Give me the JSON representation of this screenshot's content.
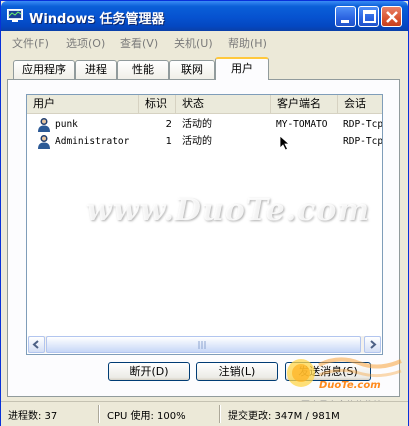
{
  "window": {
    "title": "Windows 任务管理器"
  },
  "menu": [
    "文件(F)",
    "选项(O)",
    "查看(V)",
    "关机(U)",
    "帮助(H)"
  ],
  "tabs": [
    "应用程序",
    "进程",
    "性能",
    "联网",
    "用户"
  ],
  "active_tab": "用户",
  "table": {
    "columns": [
      "用户",
      "标识",
      "状态",
      "客户端名",
      "会话"
    ],
    "rows": [
      {
        "user": "punk",
        "id": "2",
        "status": "活动的",
        "client": "MY-TOMATO",
        "session": "RDP-Tcp"
      },
      {
        "user": "Administrator",
        "id": "1",
        "status": "活动的",
        "client": "",
        "session": "RDP-Tcp"
      }
    ]
  },
  "buttons": {
    "disconnect": "断开(D)",
    "logoff": "注销(L)",
    "send_message": "发送消息(S)"
  },
  "status": {
    "processes": "进程数: 37",
    "cpu": "CPU 使用: 100%",
    "commit": "提交更改: 347M / 981M"
  },
  "watermark": "www.DuoTe.com",
  "logo": {
    "name": "DuoTe.com",
    "tagline": "国内最安全的软件站"
  },
  "colors": {
    "titlebar": "#0652d0",
    "tab_highlight": "#ffc83c",
    "close_button": "#d9542f"
  }
}
